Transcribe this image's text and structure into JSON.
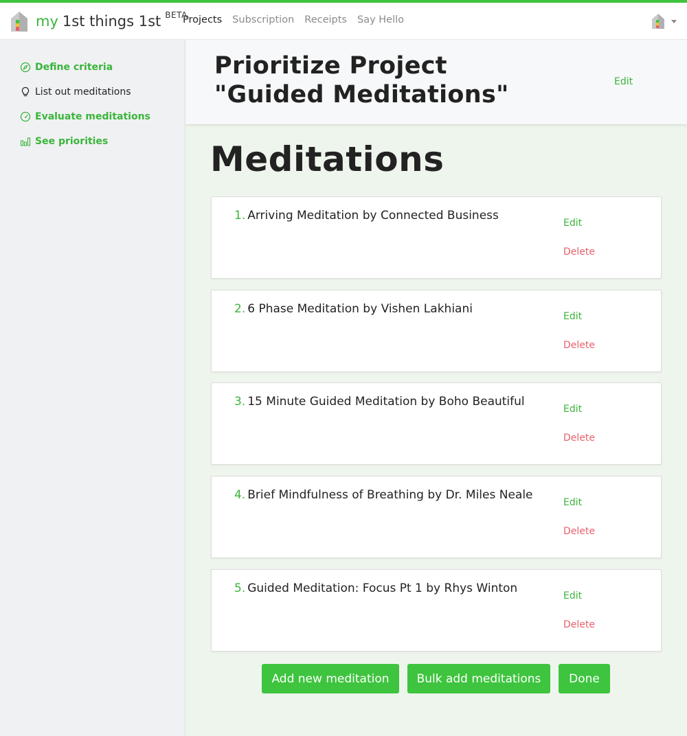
{
  "brand": {
    "my": "my",
    "rest": "1st things 1st",
    "beta": "BETA"
  },
  "nav": {
    "links": [
      "Projects",
      "Subscription",
      "Receipts",
      "Say Hello"
    ],
    "active": "Projects"
  },
  "sidebar": {
    "items": [
      {
        "label": "Define criteria",
        "icon": "compass-icon"
      },
      {
        "label": "List out meditations",
        "icon": "lightbulb-icon"
      },
      {
        "label": "Evaluate meditations",
        "icon": "gauge-icon"
      },
      {
        "label": "See priorities",
        "icon": "bar-chart-icon"
      }
    ]
  },
  "header": {
    "title_line1": "Prioritize Project",
    "title_line2": "\"Guided Meditations\"",
    "edit_label": "Edit"
  },
  "main": {
    "section_title": "Meditations"
  },
  "meditations": [
    {
      "num": "1.",
      "title": "Arriving Meditation by Connected Business",
      "edit": "Edit",
      "delete": "Delete"
    },
    {
      "num": "2.",
      "title": "6 Phase Meditation by Vishen Lakhiani",
      "edit": "Edit",
      "delete": "Delete"
    },
    {
      "num": "3.",
      "title": "15 Minute Guided Meditation by Boho Beautiful",
      "edit": "Edit",
      "delete": "Delete"
    },
    {
      "num": "4.",
      "title": "Brief Mindfulness of Breathing by Dr. Miles Neale",
      "edit": "Edit",
      "delete": "Delete"
    },
    {
      "num": "5.",
      "title": "Guided Meditation: Focus Pt 1 by Rhys Winton",
      "edit": "Edit",
      "delete": "Delete"
    }
  ],
  "buttons": {
    "add": "Add new meditation",
    "bulk": "Bulk add meditations",
    "done": "Done"
  },
  "colors": {
    "accent": "#3ec43e",
    "delete": "#e8606a",
    "background": "#eef5ec",
    "sidebar": "#f0f1f3"
  }
}
